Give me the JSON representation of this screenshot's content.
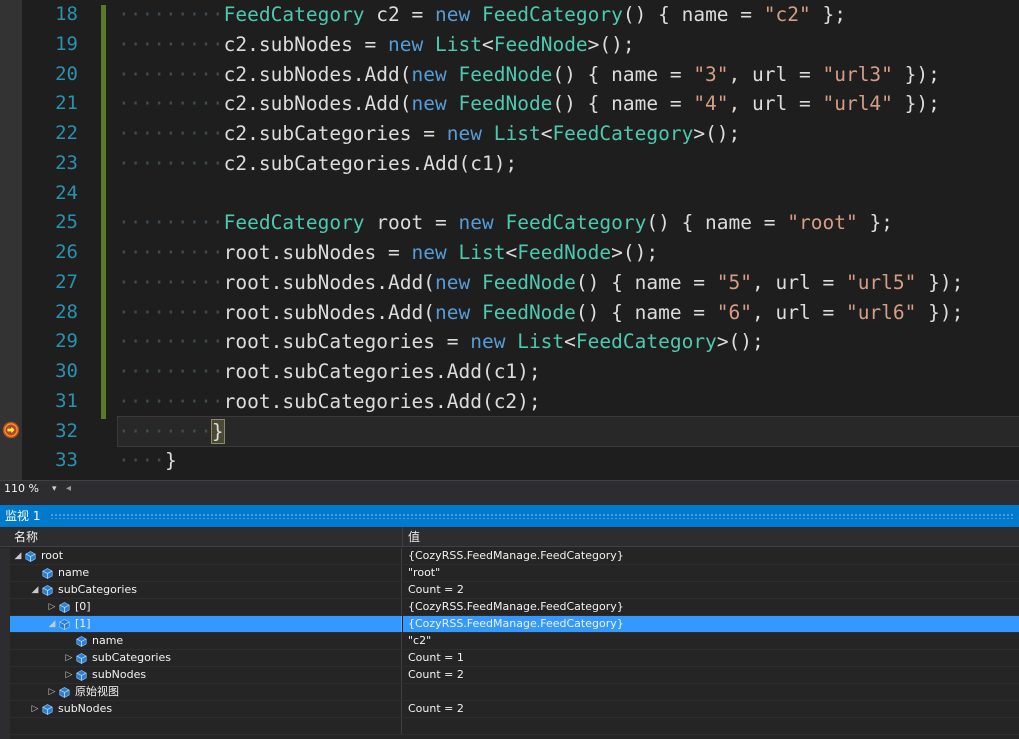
{
  "editor": {
    "line_numbers": [
      "18",
      "19",
      "20",
      "21",
      "22",
      "23",
      "24",
      "25",
      "26",
      "27",
      "28",
      "29",
      "30",
      "31",
      "32",
      "33"
    ],
    "lines": [
      [
        [
          "ws",
          "·········"
        ],
        [
          "ty",
          "FeedCategory"
        ],
        [
          "p",
          " c2 = "
        ],
        [
          "kw",
          "new"
        ],
        [
          "p",
          " "
        ],
        [
          "ty",
          "FeedCategory"
        ],
        [
          "p",
          "() { name = "
        ],
        [
          "str",
          "\"c2\""
        ],
        [
          "p",
          " };"
        ]
      ],
      [
        [
          "ws",
          "·········"
        ],
        [
          "p",
          "c2.subNodes = "
        ],
        [
          "kw",
          "new"
        ],
        [
          "p",
          " "
        ],
        [
          "ty",
          "List"
        ],
        [
          "p",
          "<"
        ],
        [
          "ty",
          "FeedNode"
        ],
        [
          "p",
          ">();"
        ]
      ],
      [
        [
          "ws",
          "·········"
        ],
        [
          "p",
          "c2.subNodes.Add("
        ],
        [
          "kw",
          "new"
        ],
        [
          "p",
          " "
        ],
        [
          "ty",
          "FeedNode"
        ],
        [
          "p",
          "() { name = "
        ],
        [
          "str",
          "\"3\""
        ],
        [
          "p",
          ", url = "
        ],
        [
          "str",
          "\"url3\""
        ],
        [
          "p",
          " });"
        ]
      ],
      [
        [
          "ws",
          "·········"
        ],
        [
          "p",
          "c2.subNodes.Add("
        ],
        [
          "kw",
          "new"
        ],
        [
          "p",
          " "
        ],
        [
          "ty",
          "FeedNode"
        ],
        [
          "p",
          "() { name = "
        ],
        [
          "str",
          "\"4\""
        ],
        [
          "p",
          ", url = "
        ],
        [
          "str",
          "\"url4\""
        ],
        [
          "p",
          " });"
        ]
      ],
      [
        [
          "ws",
          "·········"
        ],
        [
          "p",
          "c2.subCategories = "
        ],
        [
          "kw",
          "new"
        ],
        [
          "p",
          " "
        ],
        [
          "ty",
          "List"
        ],
        [
          "p",
          "<"
        ],
        [
          "ty",
          "FeedCategory"
        ],
        [
          "p",
          ">();"
        ]
      ],
      [
        [
          "ws",
          "·········"
        ],
        [
          "p",
          "c2.subCategories.Add(c1);"
        ]
      ],
      [],
      [
        [
          "ws",
          "·········"
        ],
        [
          "ty",
          "FeedCategory"
        ],
        [
          "p",
          " root = "
        ],
        [
          "kw",
          "new"
        ],
        [
          "p",
          " "
        ],
        [
          "ty",
          "FeedCategory"
        ],
        [
          "p",
          "() { name = "
        ],
        [
          "str",
          "\"root\""
        ],
        [
          "p",
          " };"
        ]
      ],
      [
        [
          "ws",
          "·········"
        ],
        [
          "p",
          "root.subNodes = "
        ],
        [
          "kw",
          "new"
        ],
        [
          "p",
          " "
        ],
        [
          "ty",
          "List"
        ],
        [
          "p",
          "<"
        ],
        [
          "ty",
          "FeedNode"
        ],
        [
          "p",
          ">();"
        ]
      ],
      [
        [
          "ws",
          "·········"
        ],
        [
          "p",
          "root.subNodes.Add("
        ],
        [
          "kw",
          "new"
        ],
        [
          "p",
          " "
        ],
        [
          "ty",
          "FeedNode"
        ],
        [
          "p",
          "() { name = "
        ],
        [
          "str",
          "\"5\""
        ],
        [
          "p",
          ", url = "
        ],
        [
          "str",
          "\"url5\""
        ],
        [
          "p",
          " });"
        ]
      ],
      [
        [
          "ws",
          "·········"
        ],
        [
          "p",
          "root.subNodes.Add("
        ],
        [
          "kw",
          "new"
        ],
        [
          "p",
          " "
        ],
        [
          "ty",
          "FeedNode"
        ],
        [
          "p",
          "() { name = "
        ],
        [
          "str",
          "\"6\""
        ],
        [
          "p",
          ", url = "
        ],
        [
          "str",
          "\"url6\""
        ],
        [
          "p",
          " });"
        ]
      ],
      [
        [
          "ws",
          "·········"
        ],
        [
          "p",
          "root.subCategories = "
        ],
        [
          "kw",
          "new"
        ],
        [
          "p",
          " "
        ],
        [
          "ty",
          "List"
        ],
        [
          "p",
          "<"
        ],
        [
          "ty",
          "FeedCategory"
        ],
        [
          "p",
          ">();"
        ]
      ],
      [
        [
          "ws",
          "·········"
        ],
        [
          "p",
          "root.subCategories.Add(c1);"
        ]
      ],
      [
        [
          "ws",
          "·········"
        ],
        [
          "p",
          "root.subCategories.Add(c2);"
        ]
      ],
      [
        [
          "ws",
          "········"
        ],
        [
          "hl",
          "}"
        ]
      ],
      [
        [
          "ws",
          "····"
        ],
        [
          "p",
          "}"
        ]
      ]
    ],
    "current_line_index": 14
  },
  "zoombar": {
    "zoom": "110 %",
    "dropdown_glyph": "▾",
    "scroll_left_glyph": "◂"
  },
  "watch": {
    "title": "监视 1",
    "col_name": "名称",
    "col_value": "值",
    "rows": [
      {
        "depth": 0,
        "expander": "expanded",
        "name": "root",
        "value": "{CozyRSS.FeedManage.FeedCategory}"
      },
      {
        "depth": 1,
        "expander": "none",
        "name": "name",
        "value": "\"root\""
      },
      {
        "depth": 1,
        "expander": "expanded",
        "name": "subCategories",
        "value": "Count = 2"
      },
      {
        "depth": 2,
        "expander": "collapsed",
        "name": "[0]",
        "value": "{CozyRSS.FeedManage.FeedCategory}"
      },
      {
        "depth": 2,
        "expander": "expanded",
        "name": "[1]",
        "value": "{CozyRSS.FeedManage.FeedCategory}",
        "selected": true
      },
      {
        "depth": 3,
        "expander": "none",
        "name": "name",
        "value": "\"c2\""
      },
      {
        "depth": 3,
        "expander": "collapsed",
        "name": "subCategories",
        "value": "Count = 1"
      },
      {
        "depth": 3,
        "expander": "collapsed",
        "name": "subNodes",
        "value": "Count = 2"
      },
      {
        "depth": 2,
        "expander": "collapsed",
        "name": "原始视图",
        "value": ""
      },
      {
        "depth": 1,
        "expander": "collapsed",
        "name": "subNodes",
        "value": "Count = 2"
      },
      {
        "depth": 0,
        "expander": "none",
        "name": "",
        "value": "",
        "empty": true
      }
    ]
  },
  "colors": {
    "keyword": "#569cd6",
    "type": "#4ec9b0",
    "string": "#d69d85",
    "line_number": "#2b91af",
    "accent": "#007acc",
    "selection": "#3399ff"
  },
  "icons": {
    "breakpoint": "current-statement-arrow-icon",
    "field": "field-cube-icon",
    "expanded": "expanded-triangle-icon",
    "collapsed": "collapsed-triangle-icon"
  }
}
